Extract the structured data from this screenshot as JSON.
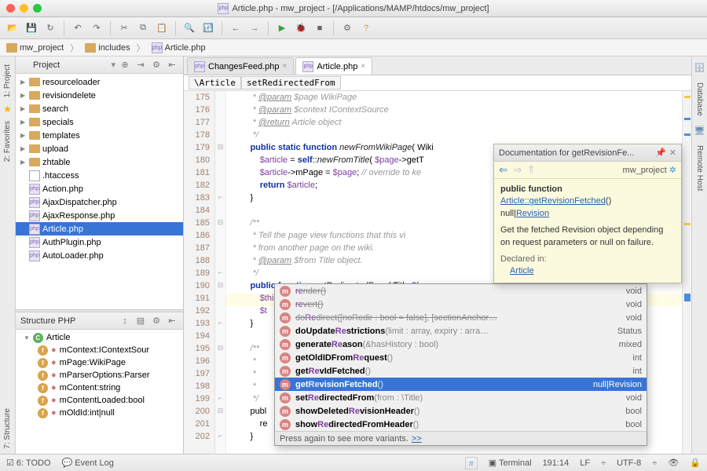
{
  "window": {
    "title": "Article.php - mw_project - [/Applications/MAMP/htdocs/mw_project]",
    "file_icon": "php"
  },
  "breadcrumb": [
    "mw_project",
    "includes",
    "Article.php"
  ],
  "project_panel": {
    "title": "Project",
    "folders": [
      "resourceloader",
      "revisiondelete",
      "search",
      "specials",
      "templates",
      "upload",
      "zhtable"
    ],
    "files": [
      {
        "name": ".htaccess",
        "type": "txt"
      },
      {
        "name": "Action.php",
        "type": "php"
      },
      {
        "name": "AjaxDispatcher.php",
        "type": "php"
      },
      {
        "name": "AjaxResponse.php",
        "type": "php"
      },
      {
        "name": "Article.php",
        "type": "php",
        "selected": true
      },
      {
        "name": "AuthPlugin.php",
        "type": "php"
      },
      {
        "name": "AutoLoader.php",
        "type": "php"
      }
    ]
  },
  "structure_panel": {
    "title": "Structure PHP",
    "class": "Article",
    "members": [
      "mContext:IContextSour",
      "mPage:WikiPage",
      "mParserOptions:Parser",
      "mContent:string",
      "mContentLoaded:bool",
      "mOldId:int|null"
    ]
  },
  "left_tabs": [
    "1: Project",
    "2: Favorites",
    "7: Structure"
  ],
  "right_tabs": [
    "Database",
    "Remote Host"
  ],
  "editor": {
    "tabs": [
      {
        "name": "ChangesFeed.php",
        "active": false
      },
      {
        "name": "Article.php",
        "active": true
      }
    ],
    "nav": [
      "\\Article",
      "setRedirectedFrom"
    ],
    "first_line": 175,
    "highlight_line": 191,
    "typed": "$this->re",
    "lines": [
      {
        "t": "doc",
        "s": "         * @param $page WikiPage"
      },
      {
        "t": "doc",
        "s": "         * @param $context IContextSource"
      },
      {
        "t": "doc",
        "s": "         * @return Article object"
      },
      {
        "t": "doc",
        "s": "         */"
      },
      {
        "t": "code",
        "s": "        public static function newFromWikiPage( Wiki"
      },
      {
        "t": "code",
        "s": "            $article = self::newFromTitle( $page->getT"
      },
      {
        "t": "code",
        "s": "            $article->mPage = $page; // override to ke"
      },
      {
        "t": "code",
        "s": "            return $article;"
      },
      {
        "t": "code",
        "s": "        }"
      },
      {
        "t": "blank",
        "s": ""
      },
      {
        "t": "doc",
        "s": "        /**"
      },
      {
        "t": "doc",
        "s": "         * Tell the page view functions that this vi"
      },
      {
        "t": "doc",
        "s": "         * from another page on the wiki."
      },
      {
        "t": "doc",
        "s": "         * @param $from Title object."
      },
      {
        "t": "doc",
        "s": "         */"
      },
      {
        "t": "code",
        "s": "        public function setRedirectedFrom( Title $fr"
      },
      {
        "t": "hi",
        "s": "            $this->re"
      },
      {
        "t": "code",
        "s": "            $t"
      },
      {
        "t": "code",
        "s": "        }"
      },
      {
        "t": "blank",
        "s": ""
      },
      {
        "t": "doc",
        "s": "        /**"
      },
      {
        "t": "doc",
        "s": "         *"
      },
      {
        "t": "doc",
        "s": "         *"
      },
      {
        "t": "doc",
        "s": "         *"
      },
      {
        "t": "doc",
        "s": "         */"
      },
      {
        "t": "code",
        "s": "        publ"
      },
      {
        "t": "code",
        "s": "            re"
      },
      {
        "t": "code",
        "s": "        }"
      }
    ]
  },
  "autocomplete": {
    "items": [
      {
        "name": "render",
        "params": "()",
        "type": "void",
        "strike": true
      },
      {
        "name": "revert",
        "params": "()",
        "type": "void",
        "strike": true
      },
      {
        "name": "doRedirect",
        "params": "([noRedir : bool = false], [sectionAnchor…",
        "type": "void",
        "strike": true
      },
      {
        "name": "doUpdateRestrictions",
        "params": "(limit : array, expiry : arra…",
        "type": "Status"
      },
      {
        "name": "generateReason",
        "params": "(&hasHistory : bool)",
        "type": "mixed"
      },
      {
        "name": "getOldIDFromRequest",
        "params": "()",
        "type": "int"
      },
      {
        "name": "getRevIdFetched",
        "params": "()",
        "type": "int"
      },
      {
        "name": "getRevisionFetched",
        "params": "()",
        "type": "null|Revision",
        "selected": true
      },
      {
        "name": "setRedirectedFrom",
        "params": "(from : \\Title)",
        "type": "void"
      },
      {
        "name": "showDeletedRevisionHeader",
        "params": "()",
        "type": "bool"
      },
      {
        "name": "showRedirectedFromHeader",
        "params": "()",
        "type": "bool"
      }
    ],
    "footer": "Press again to see more variants.",
    "footer_link": ">>"
  },
  "doc_popup": {
    "title": "Documentation for getRevisionFe...",
    "project": "mw_project",
    "sig_pre": "public function",
    "sig_link": "Article::getRevisionFetched",
    "ret_pre": "null|",
    "ret_link": "Revision",
    "desc": "Get the fetched Revision object depending on request parameters or null on failure.",
    "declared_label": "Declared in:",
    "declared_link": "Article"
  },
  "statusbar": {
    "todo": "6: TODO",
    "eventlog": "Event Log",
    "pos": "191:14",
    "lf": "LF",
    "enc": "UTF-8",
    "terminal": "Terminal"
  }
}
